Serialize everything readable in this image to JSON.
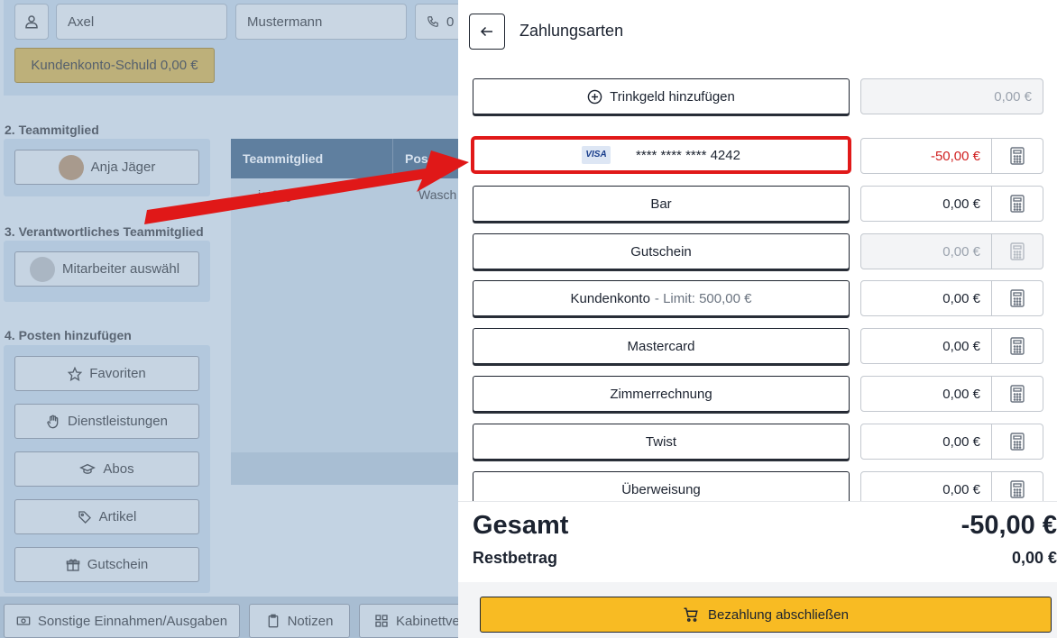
{
  "background": {
    "first_name": "Axel",
    "last_name": "Mustermann",
    "phone_partial": "0",
    "debt_button": "Kundenkonto-Schuld 0,00 €",
    "section_team": "2. Teammitglied",
    "team_member": "Anja Jäger",
    "section_responsible": "3. Verantwortliches Teammitglied",
    "select_employee": "Mitarbeiter auswähl",
    "section_items": "4. Posten hinzufügen",
    "item_buttons": [
      "Favoriten",
      "Dienstleistungen",
      "Abos",
      "Artikel",
      "Gutschein"
    ],
    "table_headers": [
      "Teammitglied",
      "Pos"
    ],
    "table_row": [
      "ja Jäger",
      "Wasch"
    ],
    "bottom_buttons": [
      "Sonstige Einnahmen/Ausgaben",
      "Notizen",
      "Kabinettve"
    ]
  },
  "panel": {
    "title": "Zahlungsarten",
    "tip": {
      "label": "Trinkgeld hinzufügen",
      "amount": "0,00 €"
    },
    "card": {
      "brand": "VISA",
      "number": "**** **** **** 4242",
      "amount": "-50,00 €"
    },
    "methods": [
      {
        "label": "Bar",
        "amount": "0,00 €",
        "disabled": false
      },
      {
        "label": "Gutschein",
        "amount": "0,00 €",
        "disabled": true
      },
      {
        "label": "Kundenkonto",
        "sublabel": "- Limit: 500,00 €",
        "amount": "0,00 €",
        "disabled": false
      },
      {
        "label": "Mastercard",
        "amount": "0,00 €",
        "disabled": false
      },
      {
        "label": "Zimmerrechnung",
        "amount": "0,00 €",
        "disabled": false
      },
      {
        "label": "Twist",
        "amount": "0,00 €",
        "disabled": false
      },
      {
        "label": "Überweisung",
        "amount": "0,00 €",
        "disabled": false
      }
    ],
    "total_label": "Gesamt",
    "total_value": "-50,00 €",
    "rest_label": "Restbetrag",
    "rest_value": "0,00 €",
    "pay_button": "Bezahlung abschließen"
  },
  "colors": {
    "accent": "#f8bb23",
    "highlight": "#e11919",
    "negative": "#d02020"
  },
  "icons": [
    "user-icon",
    "phone-icon",
    "star-icon",
    "hand-icon",
    "graduation-cap-icon",
    "tag-icon",
    "gift-icon",
    "arrow-left-icon",
    "plus-circle-icon",
    "calculator-icon",
    "cart-icon"
  ]
}
